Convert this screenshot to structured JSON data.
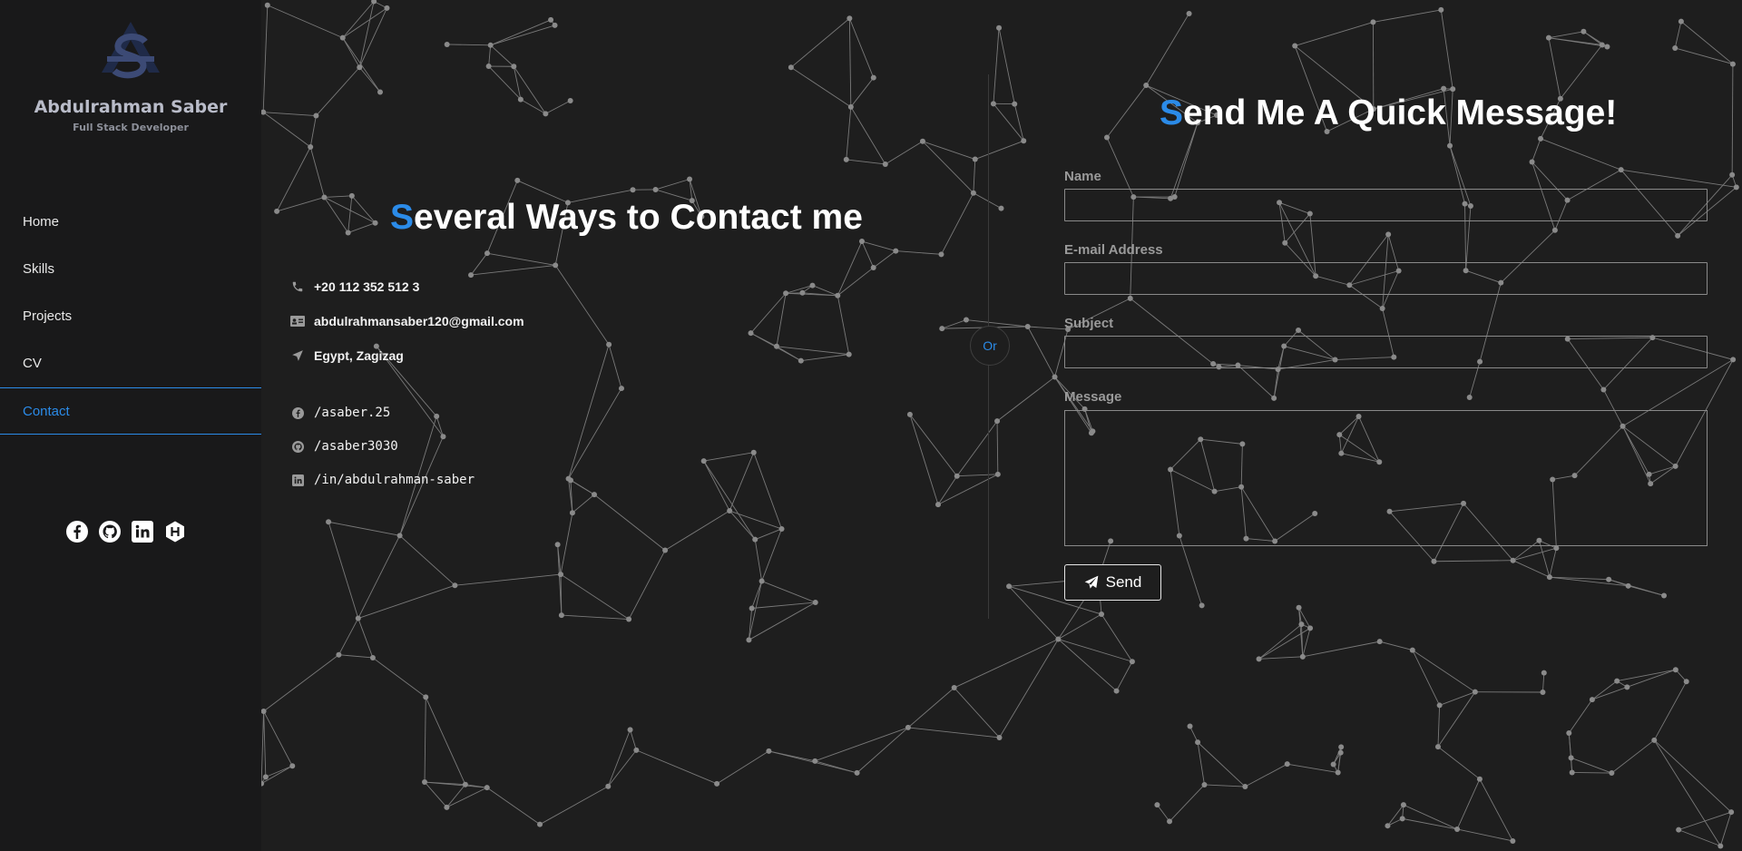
{
  "sidebar": {
    "name": "Abdulrahman Saber",
    "subtitle": "Full Stack Developer",
    "nav": [
      {
        "label": "Home"
      },
      {
        "label": "Skills"
      },
      {
        "label": "Projects"
      },
      {
        "label": "CV"
      },
      {
        "label": "Contact",
        "active": true
      }
    ],
    "social_icons": [
      "facebook-icon",
      "github-icon",
      "linkedin-icon",
      "hashnode-icon"
    ]
  },
  "contact": {
    "heading_first": "S",
    "heading_rest": "everal Ways to Contact me",
    "phone": "+20 112 352 512 3",
    "email": "abdulrahmansaber120@gmail.com",
    "location": "Egypt, Zagizag",
    "facebook": "/asaber.25",
    "github": "/asaber3030",
    "linkedin": "/in/abdulrahman-saber"
  },
  "divider_label": "Or",
  "form": {
    "heading_first": "S",
    "heading_rest": "end Me A Quick Message!",
    "name_label": "Name",
    "email_label": "E-mail Address",
    "subject_label": "Subject",
    "message_label": "Message",
    "name_value": "",
    "email_value": "",
    "subject_value": "",
    "message_value": "",
    "send_label": "Send"
  },
  "colors": {
    "accent": "#2b8be8",
    "background": "#1e1e1e",
    "sidebar": "#19191a",
    "network": "#8a8a8a"
  }
}
